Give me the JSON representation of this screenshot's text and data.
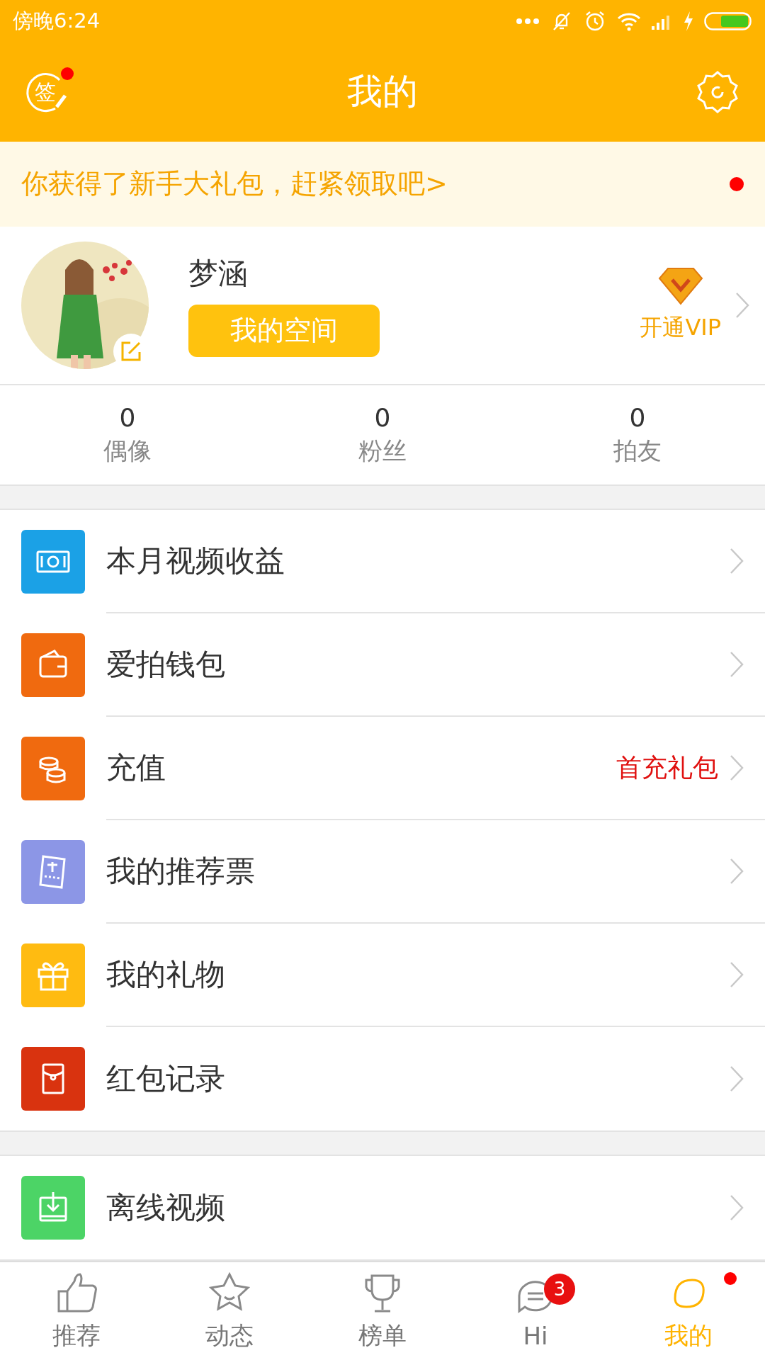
{
  "status_bar": {
    "time": "傍晚6:24"
  },
  "header": {
    "title": "我的",
    "sign_label": "签",
    "sign_dot": true
  },
  "banner": {
    "text": "你获得了新手大礼包，赶紧领取吧>",
    "dot": true
  },
  "profile": {
    "name": "梦涵",
    "space_button": "我的空间",
    "vip_label": "开通VIP"
  },
  "stats": [
    {
      "value": "0",
      "label": "偶像"
    },
    {
      "value": "0",
      "label": "粉丝"
    },
    {
      "value": "0",
      "label": "拍友"
    }
  ],
  "menu_groups": [
    [
      {
        "label": "本月视频收益",
        "color": "#1ba1e6"
      },
      {
        "label": "爱拍钱包",
        "color": "#f06a0f"
      },
      {
        "label": "充值",
        "color": "#f06a0f",
        "note": "首充礼包"
      },
      {
        "label": "我的推荐票",
        "color": "#8c96e6"
      },
      {
        "label": "我的礼物",
        "color": "#ffbb11"
      },
      {
        "label": "红包记录",
        "color": "#d9330f"
      }
    ],
    [
      {
        "label": "离线视频",
        "color": "#4cd466"
      }
    ]
  ],
  "nav": [
    {
      "label": "推荐",
      "selected": false
    },
    {
      "label": "动态",
      "selected": false
    },
    {
      "label": "榜单",
      "selected": false
    },
    {
      "label": "Hi",
      "selected": false,
      "badge": "3"
    },
    {
      "label": "我的",
      "selected": true,
      "dot": true
    }
  ]
}
